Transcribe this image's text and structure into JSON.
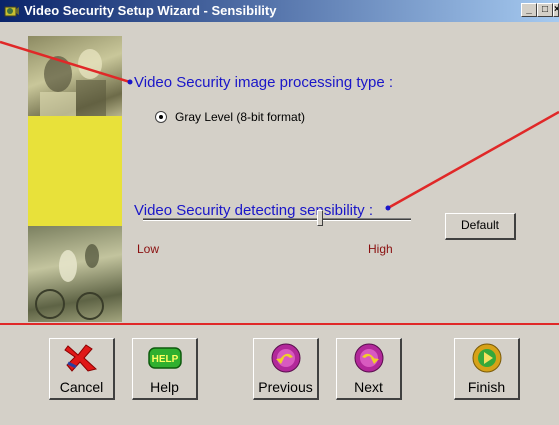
{
  "window": {
    "title": "Video Security Setup Wizard - Sensibility",
    "controls": {
      "minimize": "_",
      "maximize": "□",
      "close": "×"
    }
  },
  "processing": {
    "label": "Video Security image processing type :",
    "radio_label": "Gray Level  (8-bit format)",
    "selected": true
  },
  "sensibility": {
    "label": "Video Security detecting sensibility :",
    "low_label": "Low",
    "high_label": "High",
    "value": 0.66,
    "default_button": "Default"
  },
  "buttons": {
    "cancel": "Cancel",
    "help": "Help",
    "help_icon_text": "HELP",
    "previous": "Previous",
    "next": "Next",
    "finish": "Finish"
  },
  "icons": {
    "app": "camera-icon",
    "cancel": "cancel-x-icon",
    "help": "help-icon",
    "previous": "previous-icon",
    "next": "next-icon",
    "finish": "finish-icon"
  },
  "colors": {
    "label_blue": "#1a16c8",
    "range_red": "#8a0f0f",
    "divider_red": "#e02828",
    "callout_red": "#e02828"
  }
}
